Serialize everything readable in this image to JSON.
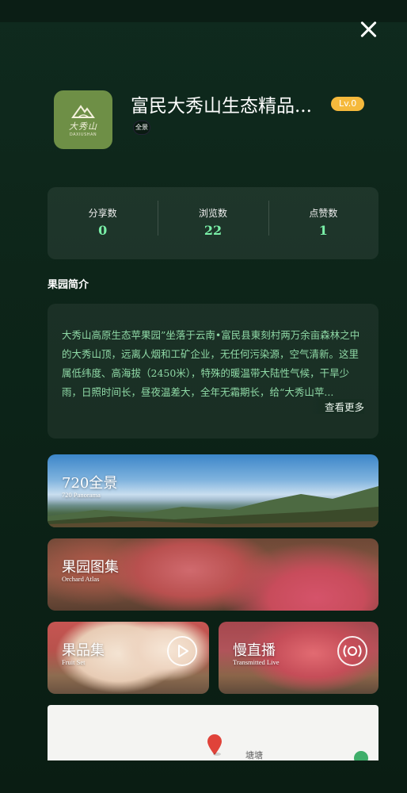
{
  "header": {
    "close_label": "",
    "title": "富民大秀山生态精品...",
    "level_badge": "Lv.0",
    "panorama_badge": "全景",
    "logo": {
      "cn": "大秀山",
      "en": "DAXIUSHAN"
    }
  },
  "stats": [
    {
      "label": "分享数",
      "value": "0"
    },
    {
      "label": "浏览数",
      "value": "22"
    },
    {
      "label": "点赞数",
      "value": "1"
    }
  ],
  "intro": {
    "section_title": "果园简介",
    "text": "大秀山高原生态苹果园”坐落于云南•富民县東刻村两万余亩森林之中的大秀山顶，远离人烟和工矿企业，无任何污染源，空气清新。这里属低纬度、高海拔（2450米），特殊的暖温带大陆性气候，干旱少雨，日照时间长，昼夜温差大，全年无霜期长，给“大秀山苹...",
    "more_label": "查看更多"
  },
  "cards": {
    "panorama": {
      "title": "720全景",
      "subtitle": "720 Panorama"
    },
    "atlas": {
      "title": "果园图集",
      "subtitle": "Orchard Atlas"
    },
    "fruit": {
      "title": "果品集",
      "subtitle": "Fruit Set"
    },
    "live": {
      "title": "慢直播",
      "subtitle": "Transmitted Live"
    }
  },
  "map": {
    "label": "塘塘"
  },
  "colors": {
    "background": "#0d2519",
    "accent_green": "#7af0a8",
    "intro_text": "#8fd9a6",
    "level_badge": "#f5b93c",
    "logo_bg": "#6e8f46"
  },
  "icons": [
    "close-icon",
    "play-icon",
    "live-icon",
    "map-pin-icon"
  ]
}
